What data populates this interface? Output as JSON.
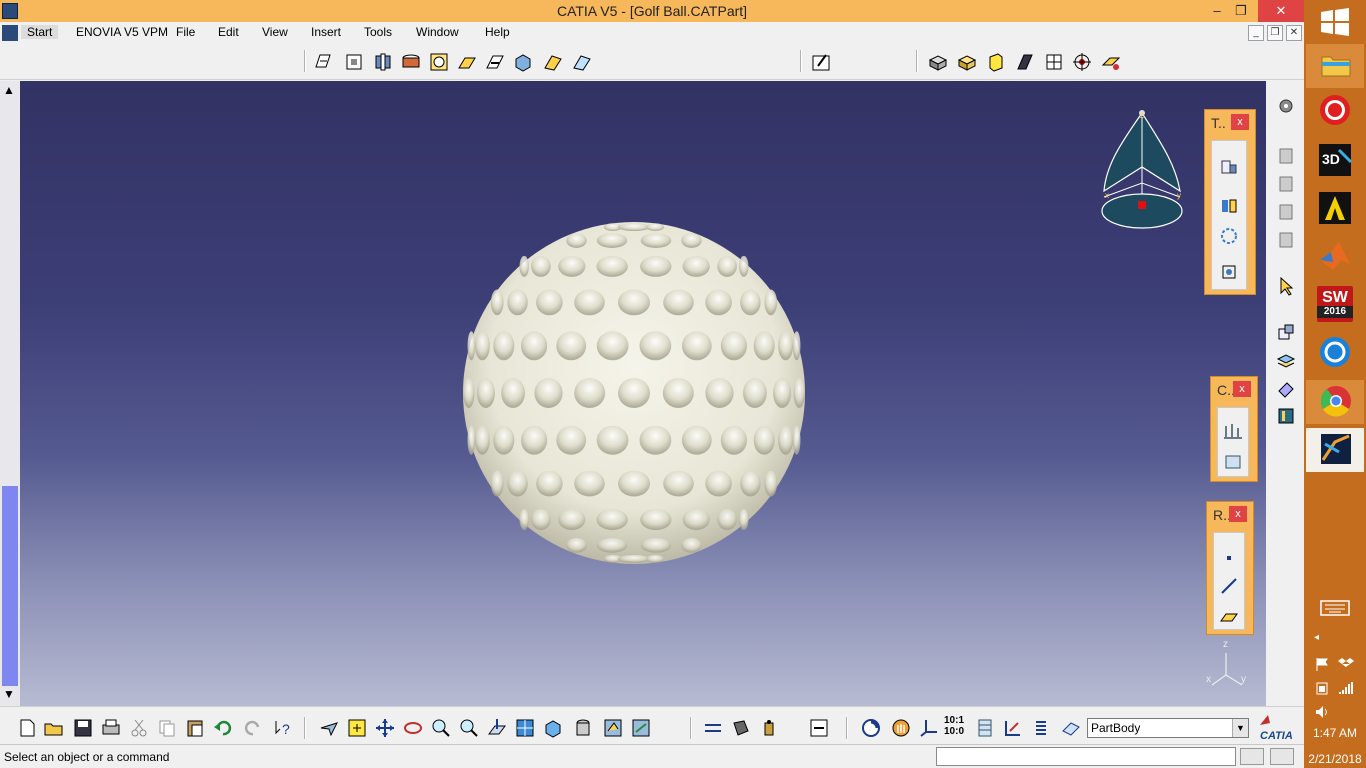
{
  "window": {
    "title": "CATIA V5 - [Golf Ball.CATPart]",
    "minimize": "–",
    "restore": "❐",
    "close": "✕"
  },
  "menu": {
    "items": [
      "Start",
      "ENOVIA V5 VPM",
      "File",
      "Edit",
      "View",
      "Insert",
      "Tools",
      "Window",
      "Help"
    ]
  },
  "panels": {
    "t": {
      "title": "T..",
      "close": "x"
    },
    "c": {
      "title": "C..",
      "close": "x"
    },
    "r": {
      "title": "R..",
      "close": "x"
    }
  },
  "compass": {
    "z": "z",
    "x": "x",
    "y": "y"
  },
  "axis": {
    "z": "z",
    "x": "x",
    "y": "y"
  },
  "bottom_toolbar": {
    "partbody_value": "PartBody",
    "scale_top": "10:1",
    "scale_bottom": "10:0"
  },
  "status": {
    "message": "Select an object or a command"
  },
  "taskbar": {
    "time": "1:47 AM",
    "date": "2/21/2018",
    "sw_year": "2016"
  },
  "colors": {
    "title_bar": "#f6b85b",
    "taskbar": "#c56d1e",
    "viewport_top": "#323264",
    "viewport_bottom": "#b7bbd2"
  }
}
